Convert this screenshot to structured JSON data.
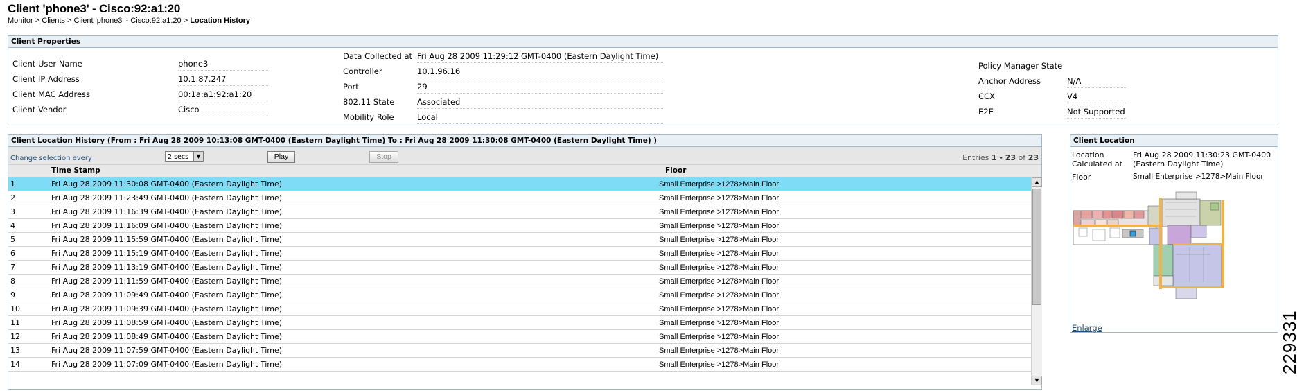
{
  "page": {
    "title": "Client 'phone3' - Cisco:92:a1:20",
    "breadcrumb": {
      "monitor": "Monitor",
      "sep": ">",
      "clients": "Clients",
      "client": "Client 'phone3' - Cisco:92:a1:20",
      "current": "Location History"
    }
  },
  "properties": {
    "header": "Client Properties",
    "col1": [
      {
        "label": "Client User Name",
        "value": "phone3"
      },
      {
        "label": "Client IP Address",
        "value": "10.1.87.247"
      },
      {
        "label": "Client MAC Address",
        "value": "00:1a:a1:92:a1:20"
      },
      {
        "label": "Client Vendor",
        "value": "Cisco"
      }
    ],
    "col2": [
      {
        "label": "Data Collected at",
        "value": "Fri Aug 28 2009 11:29:12 GMT-0400 (Eastern Daylight Time)"
      },
      {
        "label": "Controller",
        "value": "10.1.96.16"
      },
      {
        "label": "Port",
        "value": "29"
      },
      {
        "label": "802.11 State",
        "value": "Associated"
      },
      {
        "label": "Mobility Role",
        "value": "Local"
      }
    ],
    "col3": [
      {
        "label": "Policy Manager State",
        "value": ""
      },
      {
        "label": "Anchor Address",
        "value": "N/A"
      },
      {
        "label": "CCX",
        "value": "V4"
      },
      {
        "label": "E2E",
        "value": "Not Supported"
      }
    ]
  },
  "history": {
    "header": "Client Location History (From : Fri Aug 28 2009 10:13:08 GMT-0400 (Eastern Daylight Time) To : Fri Aug 28 2009 11:30:08 GMT-0400 (Eastern Daylight Time) )",
    "change_label": "Change selection every",
    "interval": "2 secs",
    "play": "Play",
    "stop": "Stop",
    "entries_prefix": "Entries",
    "entries_range": "1 - 23",
    "entries_of": "of",
    "entries_total": "23",
    "columns": {
      "timestamp": "Time Stamp",
      "floor": "Floor"
    },
    "rows": [
      {
        "n": "1",
        "time": "Fri Aug 28 2009 11:30:08 GMT-0400 (Eastern Daylight Time)",
        "floor": "Small Enterprise >1278>Main Floor"
      },
      {
        "n": "2",
        "time": "Fri Aug 28 2009 11:23:49 GMT-0400 (Eastern Daylight Time)",
        "floor": "Small Enterprise >1278>Main Floor"
      },
      {
        "n": "3",
        "time": "Fri Aug 28 2009 11:16:39 GMT-0400 (Eastern Daylight Time)",
        "floor": "Small Enterprise >1278>Main Floor"
      },
      {
        "n": "4",
        "time": "Fri Aug 28 2009 11:16:09 GMT-0400 (Eastern Daylight Time)",
        "floor": "Small Enterprise >1278>Main Floor"
      },
      {
        "n": "5",
        "time": "Fri Aug 28 2009 11:15:59 GMT-0400 (Eastern Daylight Time)",
        "floor": "Small Enterprise >1278>Main Floor"
      },
      {
        "n": "6",
        "time": "Fri Aug 28 2009 11:15:19 GMT-0400 (Eastern Daylight Time)",
        "floor": "Small Enterprise >1278>Main Floor"
      },
      {
        "n": "7",
        "time": "Fri Aug 28 2009 11:13:19 GMT-0400 (Eastern Daylight Time)",
        "floor": "Small Enterprise >1278>Main Floor"
      },
      {
        "n": "8",
        "time": "Fri Aug 28 2009 11:11:59 GMT-0400 (Eastern Daylight Time)",
        "floor": "Small Enterprise >1278>Main Floor"
      },
      {
        "n": "9",
        "time": "Fri Aug 28 2009 11:09:49 GMT-0400 (Eastern Daylight Time)",
        "floor": "Small Enterprise >1278>Main Floor"
      },
      {
        "n": "10",
        "time": "Fri Aug 28 2009 11:09:39 GMT-0400 (Eastern Daylight Time)",
        "floor": "Small Enterprise >1278>Main Floor"
      },
      {
        "n": "11",
        "time": "Fri Aug 28 2009 11:08:59 GMT-0400 (Eastern Daylight Time)",
        "floor": "Small Enterprise >1278>Main Floor"
      },
      {
        "n": "12",
        "time": "Fri Aug 28 2009 11:08:49 GMT-0400 (Eastern Daylight Time)",
        "floor": "Small Enterprise >1278>Main Floor"
      },
      {
        "n": "13",
        "time": "Fri Aug 28 2009 11:07:59 GMT-0400 (Eastern Daylight Time)",
        "floor": "Small Enterprise >1278>Main Floor"
      },
      {
        "n": "14",
        "time": "Fri Aug 28 2009 11:07:09 GMT-0400 (Eastern Daylight Time)",
        "floor": "Small Enterprise >1278>Main Floor"
      }
    ]
  },
  "location": {
    "header": "Client Location",
    "calc_label": "Location Calculated at",
    "calc_value": "Fri Aug 28 2009 11:30:23 GMT-0400 (Eastern Daylight Time)",
    "floor_label": "Floor",
    "floor_value": "Small Enterprise >1278>Main Floor",
    "enlarge": "Enlarge"
  },
  "figure_number": "229331",
  "colors": {
    "selected_row": "#7fdcf7",
    "panel_border": "#9fb7c9",
    "panel_header": "#e8eff5"
  }
}
